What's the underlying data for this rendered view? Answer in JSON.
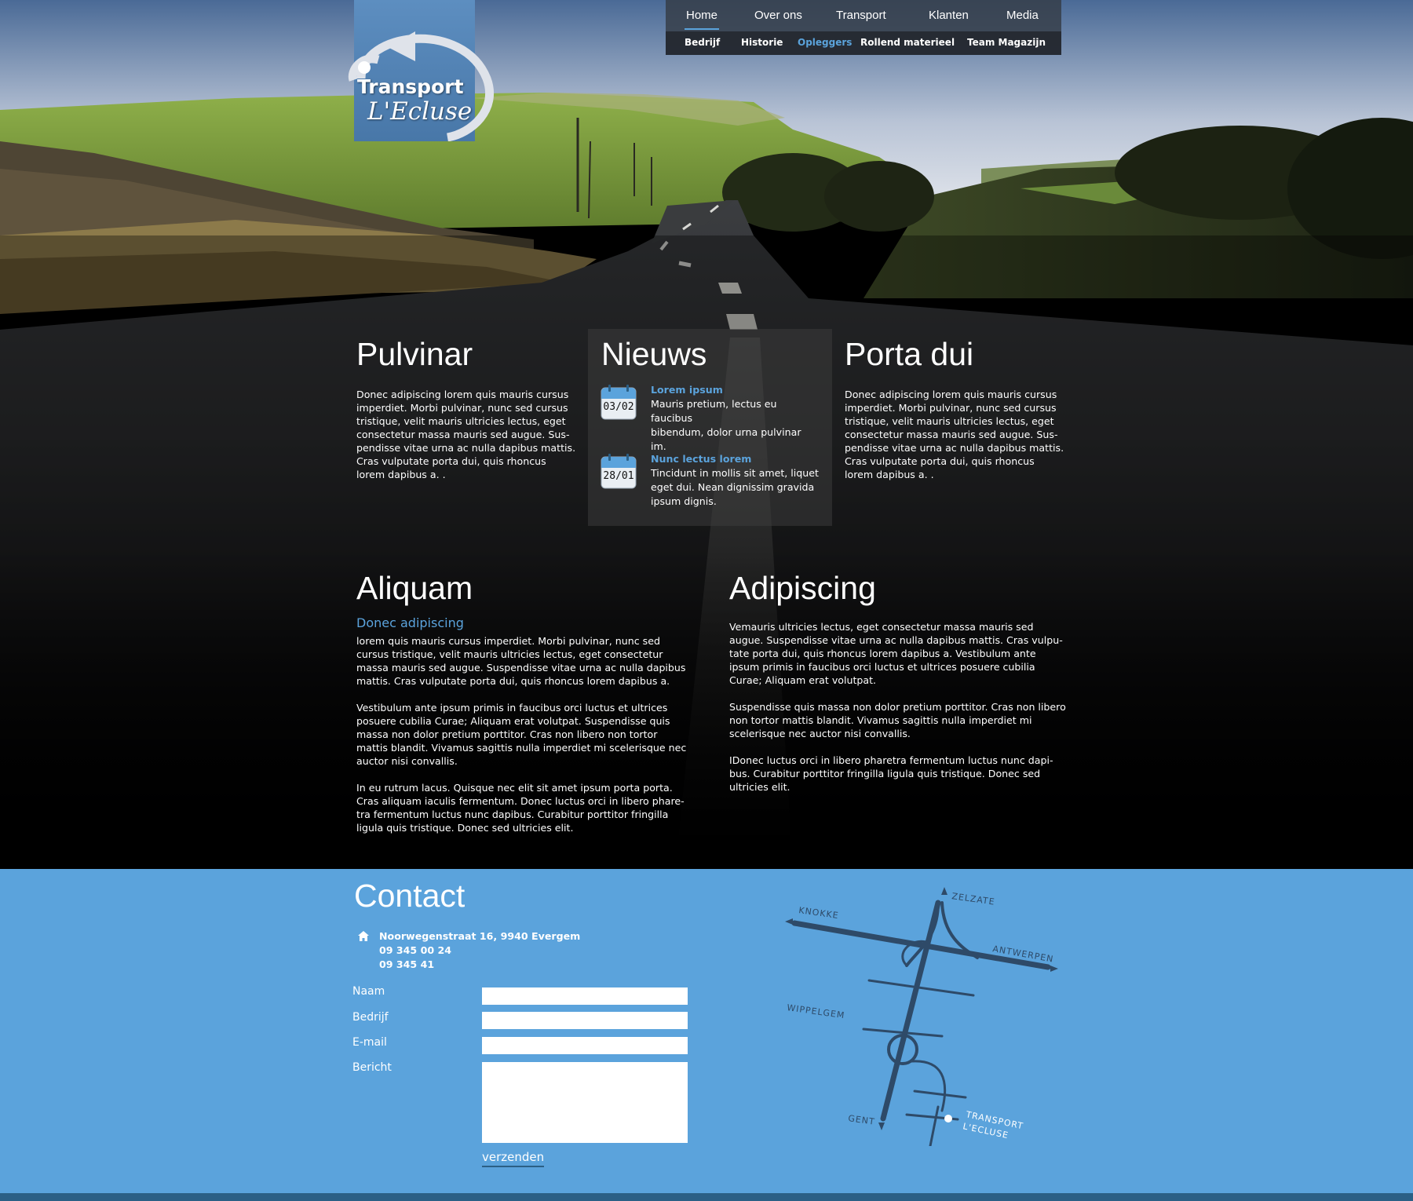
{
  "logo": {
    "line1": "Transport",
    "line2": "L'Ecluse"
  },
  "nav": {
    "main": [
      {
        "label": "Home",
        "active": true
      },
      {
        "label": "Over ons",
        "active": false
      },
      {
        "label": "Transport",
        "active": false
      },
      {
        "label": "Klanten",
        "active": false
      },
      {
        "label": "Media",
        "active": false
      }
    ],
    "sub": [
      {
        "label": "Bedrijf",
        "active": false
      },
      {
        "label": "Historie",
        "active": false
      },
      {
        "label": "Opleggers",
        "active": true
      },
      {
        "label": "Rollend materieel",
        "active": false
      },
      {
        "label": "Team Magazijn",
        "active": false
      }
    ]
  },
  "pulvinar": {
    "title": "Pulvinar",
    "lines": [
      "Donec adipiscing lorem quis mauris cursus",
      "imperdiet. Morbi pulvinar, nunc sed cursus",
      "tristique, velit mauris ultricies lectus, eget",
      "consectetur massa mauris sed augue. Sus-",
      "pendisse vitae urna ac nulla dapibus mattis.",
      "Cras vulputate porta dui, quis rhoncus",
      "lorem dapibus a. ."
    ]
  },
  "nieuws": {
    "title": "Nieuws",
    "items": [
      {
        "date": "03/02",
        "title": "Lorem ipsum",
        "lines": [
          "Mauris pretium, lectus eu faucibus",
          "bibendum, dolor urna pulvinar im."
        ]
      },
      {
        "date": "28/01",
        "title": "Nunc lectus lorem",
        "lines": [
          "Tincidunt in mollis sit amet, liquet",
          "eget dui. Nean dignissim gravida",
          "ipsum dignis."
        ]
      }
    ]
  },
  "porta": {
    "title": "Porta dui",
    "lines": [
      "Donec adipiscing lorem quis mauris cursus",
      "imperdiet. Morbi pulvinar, nunc sed cursus",
      "tristique, velit mauris ultricies lectus, eget",
      "consectetur massa mauris sed augue. Sus-",
      "pendisse vitae urna ac nulla dapibus mattis.",
      "Cras vulputate porta dui, quis rhoncus",
      "lorem dapibus a. ."
    ]
  },
  "aliquam": {
    "title": "Aliquam",
    "subtitle": "Donec adipiscing",
    "lines": [
      "lorem quis mauris cursus imperdiet. Morbi pulvinar, nunc sed",
      "cursus tristique, velit mauris ultricies lectus, eget consectetur",
      "massa mauris sed augue. Suspendisse vitae urna ac nulla dapibus",
      "mattis. Cras vulputate porta dui, quis rhoncus lorem dapibus a.",
      "",
      "Vestibulum ante ipsum primis in faucibus orci luctus et ultrices",
      "posuere cubilia Curae; Aliquam erat volutpat. Suspendisse quis",
      "massa non dolor pretium porttitor. Cras non libero non tortor",
      "mattis blandit. Vivamus sagittis nulla imperdiet mi scelerisque nec",
      "auctor nisi convallis.",
      "",
      "In eu rutrum lacus. Quisque nec elit sit amet ipsum porta porta.",
      "Cras aliquam iaculis fermentum. Donec luctus orci in libero phare-",
      "tra fermentum luctus nunc dapibus. Curabitur porttitor fringilla",
      "ligula quis tristique. Donec sed ultricies elit."
    ]
  },
  "adipiscing": {
    "title": "Adipiscing",
    "lines": [
      "Vemauris ultricies lectus, eget consectetur massa mauris sed",
      "augue. Suspendisse vitae urna ac nulla dapibus mattis. Cras vulpu-",
      "tate porta dui, quis rhoncus lorem dapibus a. Vestibulum ante",
      "ipsum primis in faucibus orci luctus et ultrices posuere cubilia",
      "Curae; Aliquam erat volutpat.",
      "",
      "Suspendisse quis massa non dolor pretium porttitor. Cras non libero",
      "non tortor mattis blandit. Vivamus sagittis nulla imperdiet mi",
      "scelerisque nec auctor nisi convallis.",
      "",
      "IDonec luctus orci in libero pharetra fermentum luctus nunc dapi-",
      "bus. Curabitur porttitor fringilla ligula quis tristique. Donec sed",
      "ultricies elit."
    ]
  },
  "contact": {
    "title": "Contact",
    "address": "Noorwegenstraat 16, 9940 Evergem",
    "phone": "09 345 00 24",
    "fax": "09 345 41",
    "labels": {
      "naam": "Naam",
      "bedrijf": "Bedrijf",
      "email": "E-mail",
      "bericht": "Bericht"
    },
    "submit": "verzenden"
  },
  "map": {
    "labels": {
      "zelzate": "ZELZATE",
      "knokke": "KNOKKE",
      "antwerpen": "ANTWERPEN",
      "wippelgem": "WIPPELGEM",
      "gent": "GENT",
      "transport": "TRANSPORT",
      "lecluse": "L'ECLUSE"
    }
  },
  "colors": {
    "accent": "#5ba3dc",
    "nav_bg": "#343c46",
    "footer_bar": "#2b5f85",
    "map_road": "#2e4a68"
  }
}
